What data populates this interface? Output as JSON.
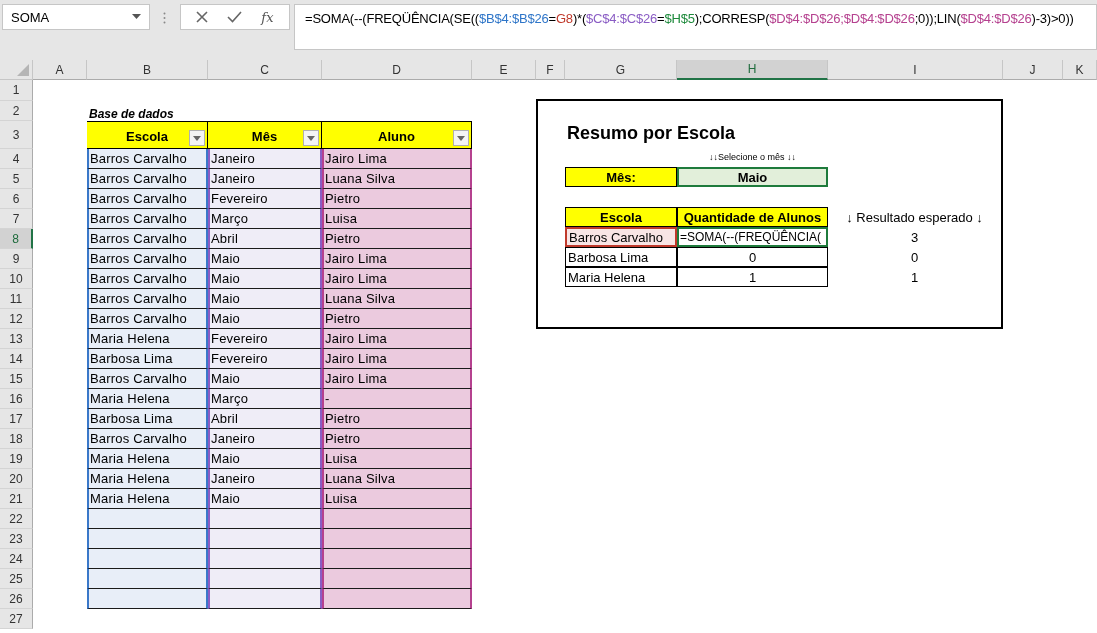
{
  "name_box": "SOMA",
  "fx_label": "fx",
  "formula": [
    {
      "text": "=SOMA(--(FREQÜÊNCIA(SE((",
      "color": "#000000"
    },
    {
      "text": "$B$4:$B$26",
      "color": "#2e75c8"
    },
    {
      "text": "=",
      "color": "#000000"
    },
    {
      "text": "G8",
      "color": "#c0392b"
    },
    {
      "text": ")*(",
      "color": "#000000"
    },
    {
      "text": "$C$4:$C$26",
      "color": "#8a5cc4"
    },
    {
      "text": "=",
      "color": "#000000"
    },
    {
      "text": "$H$5",
      "color": "#1e8a3c"
    },
    {
      "text": ");CORRESP(",
      "color": "#000000"
    },
    {
      "text": "$D$4:$D$26;$D$4:$D$26",
      "color": "#b5418f"
    },
    {
      "text": ";0));LIN(",
      "color": "#000000"
    },
    {
      "text": "$D$4:$D$26",
      "color": "#b5418f"
    },
    {
      "text": ")-3)>0))",
      "color": "#000000"
    }
  ],
  "columns": [
    {
      "label": "A",
      "selected": false
    },
    {
      "label": "B",
      "selected": false
    },
    {
      "label": "C",
      "selected": false
    },
    {
      "label": "D",
      "selected": false
    },
    {
      "label": "E",
      "selected": false
    },
    {
      "label": "F",
      "selected": false
    },
    {
      "label": "G",
      "selected": false
    },
    {
      "label": "H",
      "selected": true
    },
    {
      "label": "I",
      "selected": false
    },
    {
      "label": "J",
      "selected": false
    },
    {
      "label": "K",
      "selected": false
    }
  ],
  "rows": [
    {
      "label": "1",
      "selected": false
    },
    {
      "label": "2",
      "selected": false
    },
    {
      "label": "3",
      "selected": false
    },
    {
      "label": "4",
      "selected": false
    },
    {
      "label": "5",
      "selected": false
    },
    {
      "label": "6",
      "selected": false
    },
    {
      "label": "7",
      "selected": false
    },
    {
      "label": "8",
      "selected": true
    },
    {
      "label": "9",
      "selected": false
    },
    {
      "label": "10",
      "selected": false
    },
    {
      "label": "11",
      "selected": false
    },
    {
      "label": "12",
      "selected": false
    },
    {
      "label": "13",
      "selected": false
    },
    {
      "label": "14",
      "selected": false
    },
    {
      "label": "15",
      "selected": false
    },
    {
      "label": "16",
      "selected": false
    },
    {
      "label": "17",
      "selected": false
    },
    {
      "label": "18",
      "selected": false
    },
    {
      "label": "19",
      "selected": false
    },
    {
      "label": "20",
      "selected": false
    },
    {
      "label": "21",
      "selected": false
    },
    {
      "label": "22",
      "selected": false
    },
    {
      "label": "23",
      "selected": false
    },
    {
      "label": "24",
      "selected": false
    },
    {
      "label": "25",
      "selected": false
    },
    {
      "label": "26",
      "selected": false
    },
    {
      "label": "27",
      "selected": false
    }
  ],
  "database": {
    "title": "Base de dados",
    "headers": [
      {
        "label": "Escola",
        "color": "#3a78c9"
      },
      {
        "label": "Mês",
        "color": "#8a5cc4"
      },
      {
        "label": "Aluno",
        "color": "#b5418f"
      }
    ],
    "rows": [
      [
        "Barros Carvalho",
        "Janeiro",
        "Jairo Lima"
      ],
      [
        "Barros Carvalho",
        "Janeiro",
        "Luana Silva"
      ],
      [
        "Barros Carvalho",
        "Fevereiro",
        "Pietro"
      ],
      [
        "Barros Carvalho",
        "Março",
        "Luisa"
      ],
      [
        "Barros Carvalho",
        "Abril",
        "Pietro"
      ],
      [
        "Barros Carvalho",
        "Maio",
        "Jairo Lima"
      ],
      [
        "Barros Carvalho",
        "Maio",
        "Jairo Lima"
      ],
      [
        "Barros Carvalho",
        "Maio",
        "Luana Silva"
      ],
      [
        "Barros Carvalho",
        "Maio",
        "Pietro"
      ],
      [
        "Maria Helena",
        "Fevereiro",
        "Jairo Lima"
      ],
      [
        "Barbosa Lima",
        "Fevereiro",
        "Jairo Lima"
      ],
      [
        "Barros Carvalho",
        "Maio",
        "Jairo Lima"
      ],
      [
        "Maria Helena",
        "Março",
        "-"
      ],
      [
        "Barbosa Lima",
        "Abril",
        "Pietro"
      ],
      [
        "Barros Carvalho",
        "Janeiro",
        "Pietro"
      ],
      [
        "Maria Helena",
        "Maio",
        "Luisa"
      ],
      [
        "Maria Helena",
        "Janeiro",
        "Luana Silva"
      ],
      [
        "Maria Helena",
        "Maio",
        "Luisa"
      ]
    ]
  },
  "summary": {
    "title": "Resumo por Escola",
    "hint": "↓↓Selecione o mês ↓↓",
    "month_label": "Mês:",
    "month_value": "Maio",
    "headers": [
      "Escola",
      "Quantidade de Alunos"
    ],
    "expected_header": "↓ Resultado esperado ↓",
    "rows": [
      {
        "school": "Barros Carvalho",
        "count": "=SOMA(--(FREQÜÊNCIA(",
        "expected": "3",
        "selected": true
      },
      {
        "school": "Barbosa Lima",
        "count": "0",
        "expected": "0",
        "selected": false
      },
      {
        "school": "Maria Helena",
        "count": "1",
        "expected": "1",
        "selected": false
      }
    ]
  }
}
